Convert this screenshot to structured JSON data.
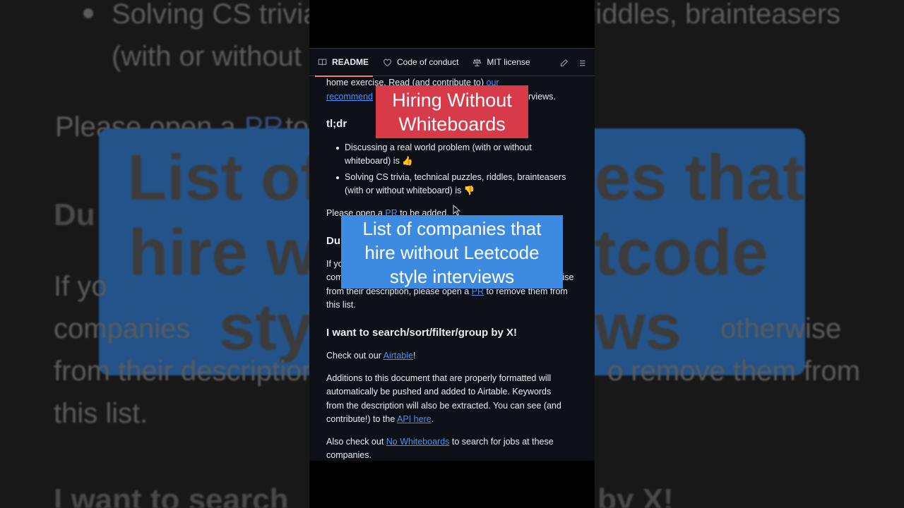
{
  "background": {
    "bullet_line1": "Solving CS trivia",
    "bullet_line1_right": "riddles, brainteasers",
    "bullet_line2": "(with or without",
    "please_open": "Please open a",
    "please_pr": "PR",
    "please_to": "to",
    "du": "Du",
    "blue_left1": "List of",
    "blue_right1": "es that",
    "blue_left2": "hire w",
    "blue_right2": "tcode",
    "blue_left3": "sty",
    "blue_right3": "ws",
    "if_yo": "If yo",
    "companies": "companies",
    "otherwise": "otherwise",
    "from_their": "from their description",
    "remove_from": "o remove them from",
    "this_list": "this list.",
    "search_left": "I want to search",
    "search_right": "by X!"
  },
  "tabs": {
    "readme": "README",
    "code_of_conduct": "Code of conduct",
    "license": "MIT license"
  },
  "content": {
    "intro_line1_pre": "home exercise. Read (and contribute to) ",
    "intro_line1_link": "our",
    "intro_line2_link": "recommend",
    "intro_line2_rest": "rviews.",
    "tldr_heading": "tl;dr",
    "bullet1_line1": "Discussing a real world problem (with or without",
    "bullet1_line2": "whiteboard) is 👍",
    "bullet2_line1": "Solving CS trivia, technical puzzles, riddles, brainteasers",
    "bullet2_line2": "(with or without whiteboard) is 👎",
    "please_pre": "Please open a ",
    "please_link": "PR",
    "please_post": " to be added.",
    "du_heading": "Du",
    "if_yo": "If yo",
    "companies_pre": "companies",
    "companies_post": "otherwise",
    "from_pre": "from their description, please open a ",
    "from_link": "PR",
    "from_post": " to remove them from",
    "this_list": "this list.",
    "search_heading": "I want to search/sort/filter/group by X!",
    "checkout_pre": "Check out our ",
    "checkout_link": "Airtable",
    "checkout_post": "!",
    "additions_line1": "Additions to this document that are properly formatted will",
    "additions_line2": "automatically be pushed and added to Airtable. Keywords",
    "additions_line3": "from the description will also be extracted. You can see (and",
    "additions_line4_pre": "contribute!) to the ",
    "additions_line4_link": "API here",
    "additions_line4_post": ".",
    "also_pre": "Also check out ",
    "also_link": "No Whiteboards",
    "also_post": " to search for jobs at these",
    "also_line2": "companies."
  },
  "overlays": {
    "red_line1": "Hiring Without",
    "red_line2": "Whiteboards",
    "blue_line1": "List of companies that",
    "blue_line2": "hire without Leetcode",
    "blue_line3": "style interviews"
  },
  "colors": {
    "panel_bg": "#0d1117",
    "link": "#4493f8",
    "red_overlay": "#d73a49",
    "blue_overlay": "#3d8be0",
    "active_tab_underline": "#f78166"
  }
}
